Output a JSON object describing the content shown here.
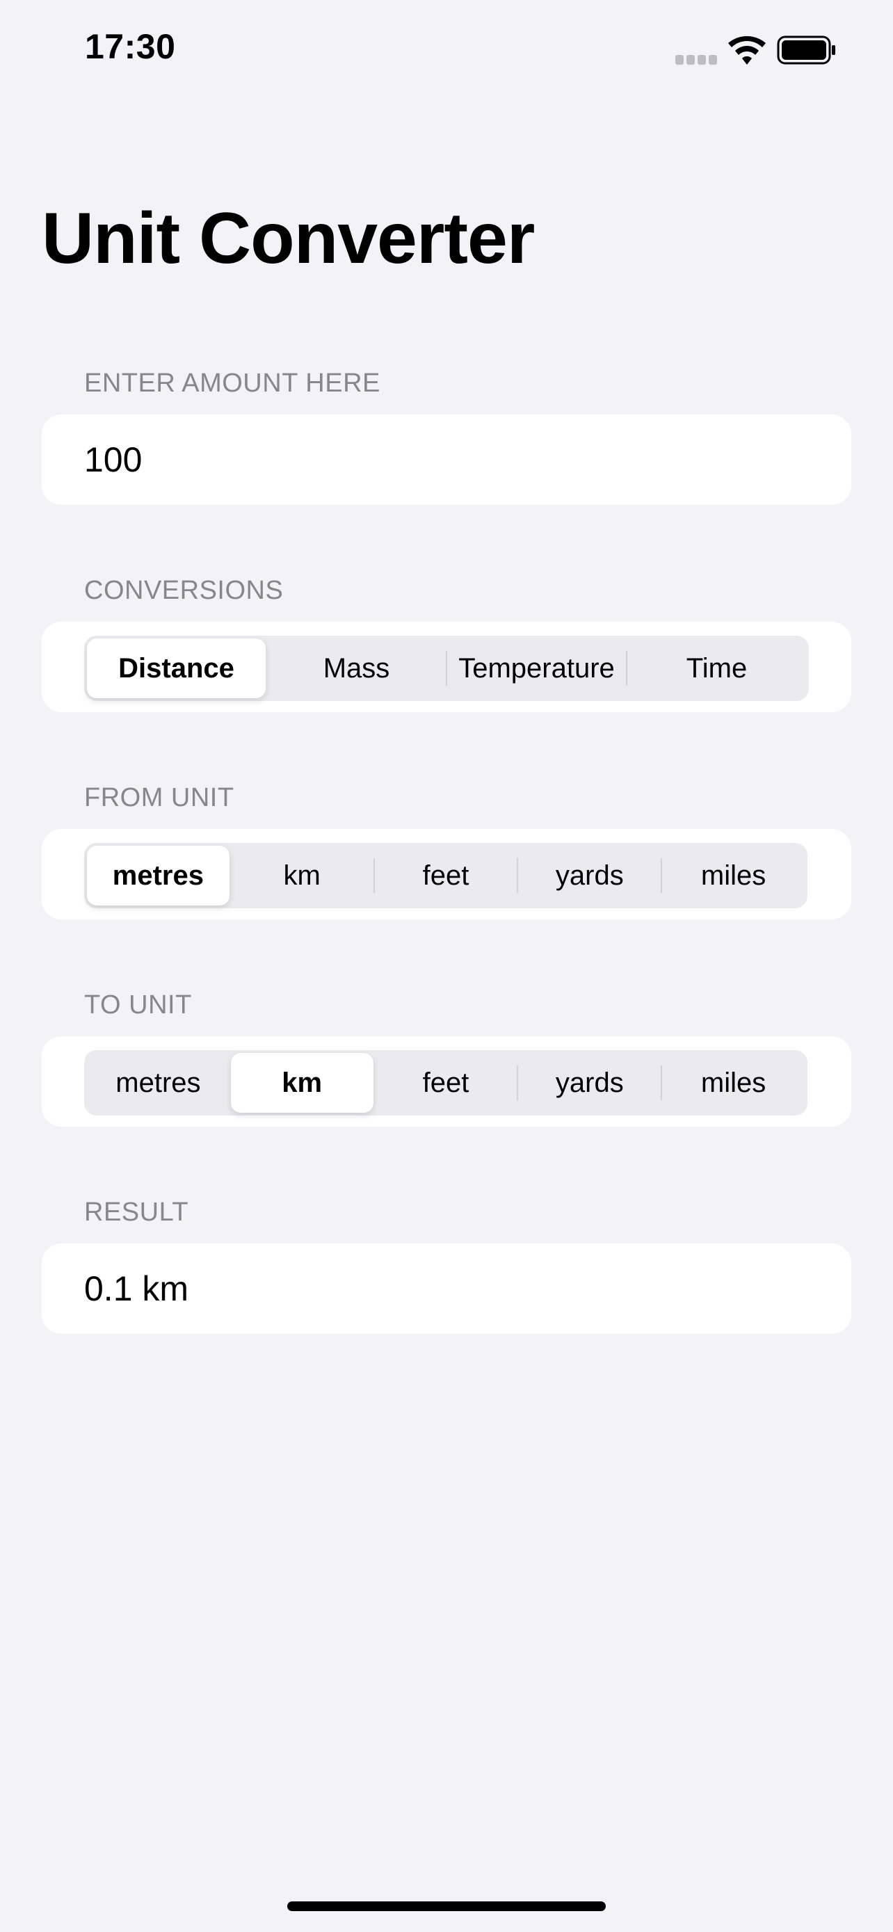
{
  "status_bar": {
    "time": "17:30",
    "icons": [
      "cellular-signal-icon",
      "wifi-icon",
      "battery-icon"
    ]
  },
  "title": "Unit Converter",
  "amount_section": {
    "header": "ENTER AMOUNT HERE",
    "value": "100"
  },
  "conversions_section": {
    "header": "CONVERSIONS",
    "options": [
      "Distance",
      "Mass",
      "Temperature",
      "Time"
    ],
    "selected": "Distance"
  },
  "from_section": {
    "header": "FROM UNIT",
    "options": [
      "metres",
      "km",
      "feet",
      "yards",
      "miles"
    ],
    "selected": "metres"
  },
  "to_section": {
    "header": "TO UNIT",
    "options": [
      "metres",
      "km",
      "feet",
      "yards",
      "miles"
    ],
    "selected": "km"
  },
  "result_section": {
    "header": "RESULT",
    "value": "0.1 km"
  },
  "colors": {
    "background": "#F2F2F7",
    "card": "#FFFFFF",
    "segment_track": "#EBEBEF",
    "section_header": "#86868B",
    "divider": "#D1D1D6",
    "text": "#000000"
  }
}
